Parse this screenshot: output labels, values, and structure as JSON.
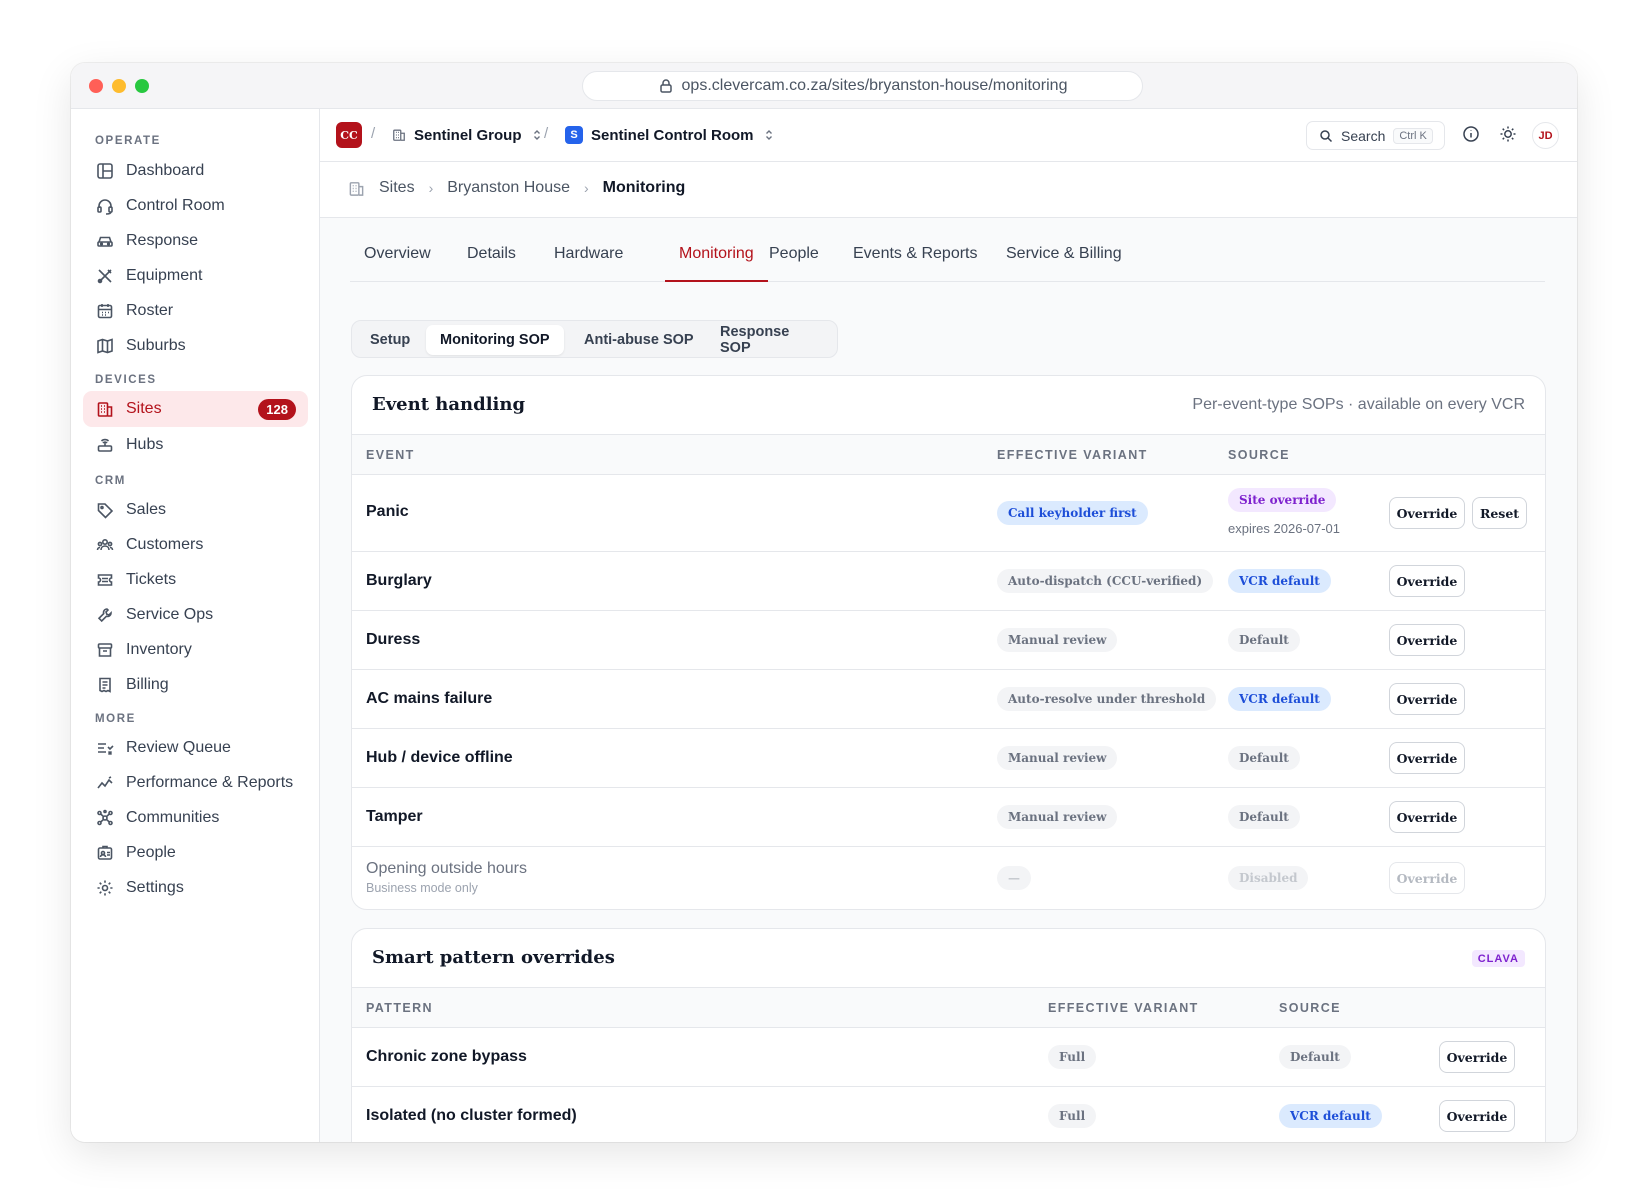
{
  "browser": {
    "url": "ops.clevercam.co.za/sites/bryanston-house/monitoring"
  },
  "topbar": {
    "org_logo": "CC",
    "org_name": "Sentinel Group",
    "workspace_badge": "S",
    "workspace_name": "Sentinel Control Room",
    "search_label": "Search",
    "search_shortcut": "Ctrl K",
    "avatar_initials": "JD"
  },
  "sidebar": {
    "sections": [
      "OPERATE",
      "DEVICES",
      "CRM",
      "MORE"
    ],
    "items": [
      {
        "label": "Dashboard",
        "icon": "layout-icon"
      },
      {
        "label": "Control Room",
        "icon": "headset-icon"
      },
      {
        "label": "Response",
        "icon": "car-icon"
      },
      {
        "label": "Equipment",
        "icon": "tools-icon"
      },
      {
        "label": "Roster",
        "icon": "calendar-icon"
      },
      {
        "label": "Suburbs",
        "icon": "map-icon"
      },
      {
        "label": "Sites",
        "icon": "building-icon",
        "badge": "128",
        "active": true
      },
      {
        "label": "Hubs",
        "icon": "router-icon"
      },
      {
        "label": "Sales",
        "icon": "tag-icon"
      },
      {
        "label": "Customers",
        "icon": "users-icon"
      },
      {
        "label": "Tickets",
        "icon": "ticket-icon"
      },
      {
        "label": "Service Ops",
        "icon": "wrench-icon"
      },
      {
        "label": "Inventory",
        "icon": "archive-icon"
      },
      {
        "label": "Billing",
        "icon": "receipt-icon"
      },
      {
        "label": "Review Queue",
        "icon": "list-check-icon"
      },
      {
        "label": "Performance & Reports",
        "icon": "chart-line-icon"
      },
      {
        "label": "Communities",
        "icon": "network-icon"
      },
      {
        "label": "People",
        "icon": "id-badge-icon"
      },
      {
        "label": "Settings",
        "icon": "gear-icon"
      }
    ]
  },
  "breadcrumb": {
    "items": [
      "Sites",
      "Bryanston House",
      "Monitoring"
    ]
  },
  "tabs": [
    "Overview",
    "Details",
    "Hardware",
    "Monitoring",
    "People",
    "Events & Reports",
    "Service & Billing"
  ],
  "active_tab": "Monitoring",
  "subtabs": [
    "Setup",
    "Monitoring SOP",
    "Anti-abuse SOP",
    "Response SOP"
  ],
  "active_subtab": "Monitoring SOP",
  "event_handling": {
    "title": "Event handling",
    "subtitle": "Per-event-type SOPs · available on every VCR",
    "columns": [
      "EVENT",
      "EFFECTIVE VARIANT",
      "SOURCE"
    ],
    "rows": [
      {
        "event": "Panic",
        "variant": "Call keyholder first",
        "variant_style": "blue",
        "source": "Site override",
        "source_style": "purple",
        "source_note": "expires 2026-07-01",
        "actions": [
          "Override",
          "Reset"
        ]
      },
      {
        "event": "Burglary",
        "variant": "Auto-dispatch (CCU-verified)",
        "variant_style": "gray",
        "source": "VCR default",
        "source_style": "blue",
        "actions": [
          "Override"
        ]
      },
      {
        "event": "Duress",
        "variant": "Manual review",
        "variant_style": "gray",
        "source": "Default",
        "source_style": "gray",
        "actions": [
          "Override"
        ]
      },
      {
        "event": "AC mains failure",
        "variant": "Auto-resolve under threshold",
        "variant_style": "gray",
        "source": "VCR default",
        "source_style": "blue",
        "actions": [
          "Override"
        ]
      },
      {
        "event": "Hub / device offline",
        "variant": "Manual review",
        "variant_style": "gray",
        "source": "Default",
        "source_style": "gray",
        "actions": [
          "Override"
        ]
      },
      {
        "event": "Tamper",
        "variant": "Manual review",
        "variant_style": "gray",
        "source": "Default",
        "source_style": "gray",
        "actions": [
          "Override"
        ]
      },
      {
        "event": "Opening outside hours",
        "event_note": "Business mode only",
        "variant": "—",
        "variant_style": "faded",
        "source": "Disabled",
        "source_style": "faded",
        "actions": [
          "Override"
        ],
        "disabled": true
      }
    ]
  },
  "smart_patterns": {
    "title": "Smart pattern overrides",
    "tag": "CLAVA",
    "columns": [
      "PATTERN",
      "EFFECTIVE VARIANT",
      "SOURCE"
    ],
    "rows": [
      {
        "pattern": "Chronic zone bypass",
        "variant": "Full",
        "source": "Default",
        "source_style": "gray",
        "actions": [
          "Override"
        ]
      },
      {
        "pattern": "Isolated (no cluster formed)",
        "variant": "Full",
        "source": "VCR default",
        "source_style": "blue",
        "actions": [
          "Override"
        ]
      }
    ]
  }
}
